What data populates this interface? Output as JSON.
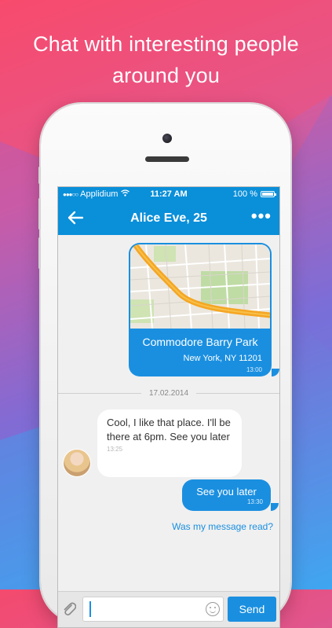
{
  "headline": {
    "line1": "Chat with interesting people",
    "line2": "around you"
  },
  "status_bar": {
    "carrier": "Applidium",
    "time": "11:27 AM",
    "battery": "100 %",
    "battery_level": 1.0
  },
  "nav_bar": {
    "title": "Alice Eve, 25",
    "back_icon": "back-arrow-icon",
    "more_icon": "more-dots-icon"
  },
  "messages": {
    "location": {
      "place_name": "Commodore Barry Park",
      "address": "New York, NY 11201",
      "time": "13:00"
    },
    "date_separator": "17.02.2014",
    "incoming": {
      "text": "Cool, I like that place. I'll be there at 6pm. See you later",
      "time": "13:25"
    },
    "outgoing": {
      "text": "See you later",
      "time": "13:30"
    },
    "read_link": "Was my message read?"
  },
  "composer": {
    "placeholder": "",
    "send_label": "Send",
    "attach_icon": "paperclip-icon",
    "emoji_icon": "smiley-icon"
  },
  "colors": {
    "accent": "#1a8fe0",
    "bar": "#0a8fd9",
    "route": "#f5a623"
  }
}
